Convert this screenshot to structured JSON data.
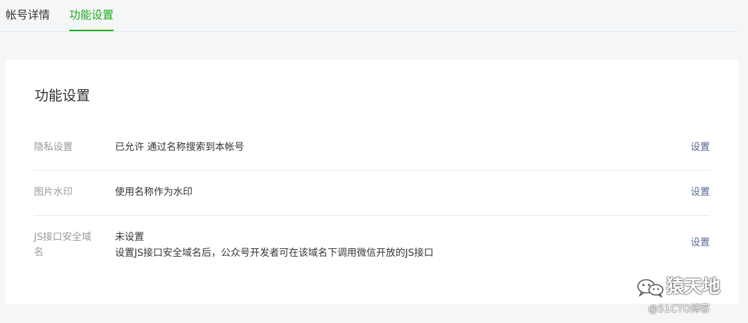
{
  "tabs": [
    {
      "label": "帐号详情",
      "active": false
    },
    {
      "label": "功能设置",
      "active": true
    }
  ],
  "colors": {
    "accent": "#1aad19",
    "link": "#576b95",
    "label": "#9a9a9a",
    "text": "#353535",
    "background": "#f5f6f7",
    "card": "#ffffff"
  },
  "card": {
    "title": "功能设置",
    "rows": [
      {
        "label": "隐私设置",
        "value": "已允许 通过名称搜索到本帐号",
        "action": "设置"
      },
      {
        "label": "图片水印",
        "value": "使用名称作为水印",
        "action": "设置"
      },
      {
        "label": "JS接口安全域名",
        "value": "未设置",
        "value2": "设置JS接口安全域名后，公众号开发者可在该域名下调用微信开放的JS接口",
        "action": "设置"
      }
    ]
  },
  "watermark": {
    "icon": "wechat-icon",
    "name": "猿天地",
    "source": "@51CTO博客"
  }
}
